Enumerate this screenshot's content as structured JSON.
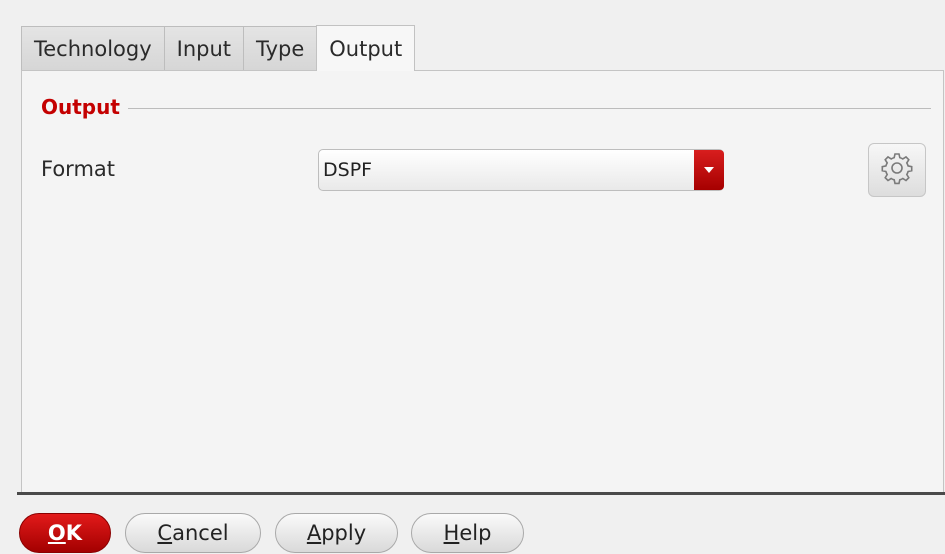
{
  "tabs": [
    {
      "label": "Technology",
      "active": false
    },
    {
      "label": "Input",
      "active": false
    },
    {
      "label": "Type",
      "active": false
    },
    {
      "label": "Output",
      "active": true
    }
  ],
  "section": {
    "title": "Output"
  },
  "format": {
    "label": "Format",
    "value": "DSPF",
    "settings_icon": "gear-icon"
  },
  "buttons": {
    "ok": {
      "mnemonic": "O",
      "rest": "K"
    },
    "cancel": {
      "mnemonic": "C",
      "rest": "ancel"
    },
    "apply": {
      "mnemonic": "A",
      "rest": "pply"
    },
    "help": {
      "mnemonic": "H",
      "rest": "elp"
    }
  },
  "colors": {
    "accent": "#c40000",
    "primary_button": "#c40000"
  }
}
